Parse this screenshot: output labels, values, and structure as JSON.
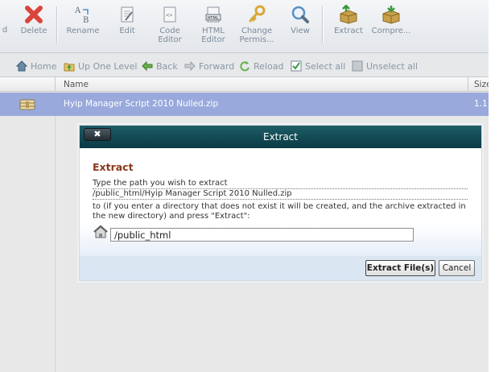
{
  "toolbar": {
    "partial_label": "d",
    "buttons": [
      {
        "id": "delete",
        "label": "Delete",
        "icon": "delete-icon"
      },
      {
        "id": "rename",
        "label": "Rename",
        "icon": "rename-icon"
      },
      {
        "id": "edit",
        "label": "Edit",
        "icon": "edit-icon"
      },
      {
        "id": "code-editor",
        "label_line1": "Code",
        "label_line2": "Editor",
        "icon": "code-editor-icon"
      },
      {
        "id": "html-editor",
        "label_line1": "HTML",
        "label_line2": "Editor",
        "icon": "html-editor-icon",
        "icon_text": "HTML"
      },
      {
        "id": "change-permissions",
        "label_line1": "Change",
        "label_line2": "Permis...",
        "icon": "key-icon"
      },
      {
        "id": "view",
        "label": "View",
        "icon": "magnifier-icon"
      },
      {
        "id": "extract",
        "label": "Extract",
        "icon": "extract-box-icon"
      },
      {
        "id": "compress",
        "label": "Compre...",
        "icon": "compress-box-icon"
      }
    ]
  },
  "navbar": {
    "home": "Home",
    "up_one_level": "Up One Level",
    "back": "Back",
    "forward": "Forward",
    "reload": "Reload",
    "select_all": "Select all",
    "unselect_all": "Unselect all"
  },
  "table": {
    "columns": [
      "Name",
      "Size"
    ],
    "rows": [
      {
        "name": "Hyip Manager Script 2010 Nulled.zip",
        "size": "1.1",
        "icon": "archive-icon",
        "selected": true
      }
    ]
  },
  "dialog": {
    "title": "Extract",
    "close_label": "✖",
    "heading": "Extract",
    "prompt": "Type the path you wish to extract",
    "source_path": "/public_html/Hyip Manager Script 2010 Nulled.zip",
    "note": "to (if you enter a directory that does not exist it will be created, and the archive extracted in the new directory) and press \"Extract\":",
    "target_path": "/public_html",
    "extract_button": "Extract File(s)",
    "cancel_button": "Cancel"
  },
  "colors": {
    "title_bar": "#0d3f49",
    "selected_row": "#99a9dc",
    "heading": "#8b3a1a",
    "toolbar_text": "#7b8a99"
  }
}
